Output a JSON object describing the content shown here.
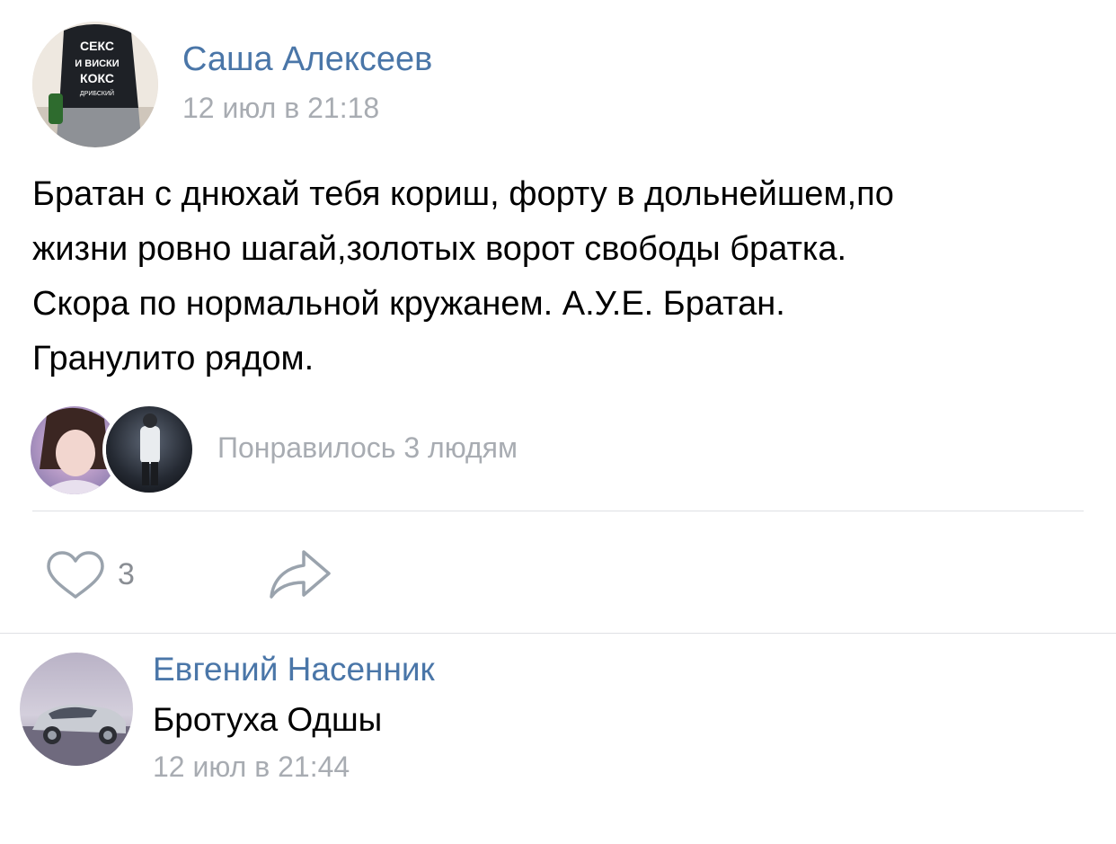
{
  "post": {
    "author": "Саша Алексеев",
    "date": "12 июл в 21:18",
    "avatar_text": [
      "СЕКС",
      "И ВИСКИ",
      "КОКС",
      "ДРИБСКИЙ"
    ],
    "text_lines": [
      "Братан с днюхай тебя кориш, форту в дольнейшем,по",
      "жизни ровно шагай,золотых ворот свободы братка.",
      "Скора по нормальной кружанем. А.У.Е. Братан.",
      "Гранулито рядом."
    ],
    "liked_text": "Понравилось 3 людям",
    "like_count": "3",
    "icons": {
      "like": "heart-icon",
      "share": "share-icon"
    }
  },
  "comment": {
    "author": "Евгений Насенник",
    "text": "Бротуха Одшы",
    "date": "12 июл в 21:44"
  },
  "colors": {
    "link": "#4a76a8",
    "muted": "#a8acb2",
    "divider": "#dfe1e4",
    "icon": "#9aa3ad"
  }
}
